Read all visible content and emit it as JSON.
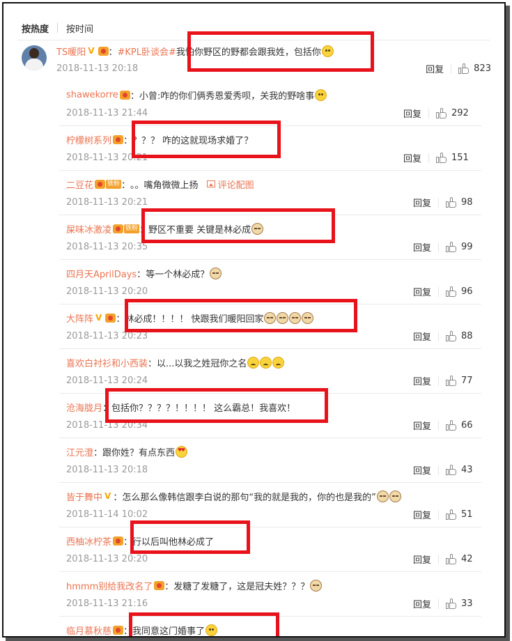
{
  "sort": {
    "hot": "按热度",
    "time": "按时间"
  },
  "top_comment": {
    "user": "TS暖阳",
    "topic": "#KPL卧谈会#",
    "text": "我怕你野区的野都会跟我姓，包括你",
    "time": "2018-11-13 20:18",
    "reply_label": "回复",
    "likes": "823"
  },
  "replies": [
    {
      "user": "shawekorre",
      "text": "小曾:咋的你们俩秀恩爱秀呗，关我的野啥事",
      "time": "2018-11-13 21:44",
      "reply_label": "回复",
      "likes": "292"
    },
    {
      "user": "柠檬树系列",
      "text": "？？？ 咋的这就现场求婚了？",
      "time": "2018-11-13 20:21",
      "reply_label": "回复",
      "likes": "151"
    },
    {
      "user": "二豆花",
      "badge": "铁粉",
      "text": "。。嘴角微微上扬",
      "pic_label": "评论配图",
      "time": "2018-11-13 20:21",
      "reply_label": "回复",
      "likes": "98"
    },
    {
      "user": "屎味冰激凌",
      "badge": "铁粉",
      "text": "野区不重要 关键是林必成",
      "time": "2018-11-13 20:35",
      "reply_label": "回复",
      "likes": "99"
    },
    {
      "user": "四月天AprilDays",
      "text": "等一个林必成？",
      "time": "2018-11-13 20:20",
      "reply_label": "回复",
      "likes": "96"
    },
    {
      "user": "大阵阵",
      "text": "林必成！！！！ 快跟我们暖阳回家",
      "time": "2018-11-13 20:23",
      "reply_label": "回复",
      "likes": "88"
    },
    {
      "user": "喜欢白衬衫和小西装",
      "text": "以...以我之姓冠你之名",
      "time": "2018-11-13 20:24",
      "reply_label": "回复",
      "likes": "77"
    },
    {
      "user": "沧海胧月",
      "text": "包括你？？？？！！！！ 这么霸总！我喜欢！",
      "time": "2018-11-13 20:34",
      "reply_label": "回复",
      "likes": "66"
    },
    {
      "user": "江元澄",
      "text": "跟你姓？有点东西",
      "time": "2018-11-13 20:18",
      "reply_label": "回复",
      "likes": "43"
    },
    {
      "user": "皆于舞中",
      "text": "怎么那么像韩信跟李白说的那句“我的就是我的，你的也是我的”",
      "time": "2018-11-14 10:02",
      "reply_label": "回复",
      "likes": "51"
    },
    {
      "user": "西柚冰柠茶",
      "text": "行以后叫他林必成了",
      "time": "2018-11-13 20:20",
      "reply_label": "回复",
      "likes": "42"
    },
    {
      "user": "hmmm别给我改名了",
      "text": "发糖了发糖了，这是冠夫姓？？？",
      "time": "2018-11-13 21:16",
      "reply_label": "回复",
      "likes": "33"
    },
    {
      "user": "临月慕秋慈",
      "text": "我同意这门婚事了",
      "time": "",
      "reply_label": "",
      "likes": ""
    }
  ],
  "colors": {
    "username": "#eb7350",
    "highlight": "#e8121b",
    "muted": "#999999"
  },
  "icons": {
    "like": "thumbs-up-icon",
    "verified": "v-badge-icon",
    "member": "member-crown-icon",
    "image": "image-icon"
  }
}
